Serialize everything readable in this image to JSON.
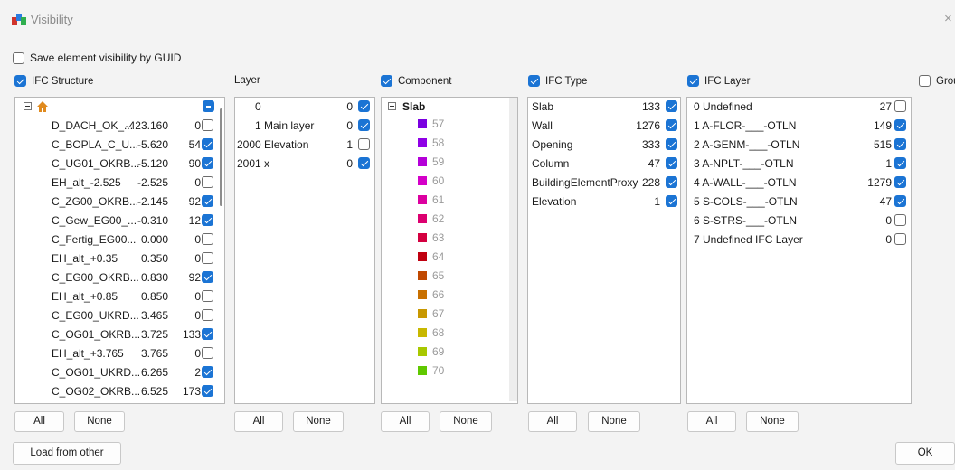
{
  "window": {
    "title": "Visibility",
    "close": "×"
  },
  "save_by_guid": {
    "label": "Save element visibility by GUID",
    "checked": false
  },
  "headers": {
    "ifc_structure": {
      "label": "IFC Structure",
      "checked": true
    },
    "layer": {
      "label": "Layer"
    },
    "component": {
      "label": "Component",
      "checked": true
    },
    "ifc_type": {
      "label": "IFC Type",
      "checked": true
    },
    "ifc_layer": {
      "label": "IFC Layer",
      "checked": true
    },
    "group": {
      "label": "Group",
      "checked": false
    }
  },
  "structure": {
    "rows": [
      {
        "name": "D_DACH_OK_...",
        "elev": "-423.160",
        "count": "0",
        "checked": false
      },
      {
        "name": "C_BOPLA_C_U...",
        "elev": "-5.620",
        "count": "54",
        "checked": true
      },
      {
        "name": "C_UG01_OKRB...",
        "elev": "-5.120",
        "count": "90",
        "checked": true
      },
      {
        "name": "EH_alt_-2.525",
        "elev": "-2.525",
        "count": "0",
        "checked": false
      },
      {
        "name": "C_ZG00_OKRB...",
        "elev": "-2.145",
        "count": "92",
        "checked": true
      },
      {
        "name": "C_Gew_EG00_...",
        "elev": "-0.310",
        "count": "12",
        "checked": true
      },
      {
        "name": "C_Fertig_EG00...",
        "elev": "0.000",
        "count": "0",
        "checked": false
      },
      {
        "name": "EH_alt_+0.35",
        "elev": "0.350",
        "count": "0",
        "checked": false
      },
      {
        "name": "C_EG00_OKRB...",
        "elev": "0.830",
        "count": "92",
        "checked": true
      },
      {
        "name": "EH_alt_+0.85",
        "elev": "0.850",
        "count": "0",
        "checked": false
      },
      {
        "name": "C_EG00_UKRD...",
        "elev": "3.465",
        "count": "0",
        "checked": false
      },
      {
        "name": "C_OG01_OKRB...",
        "elev": "3.725",
        "count": "133",
        "checked": true
      },
      {
        "name": "EH_alt_+3.765",
        "elev": "3.765",
        "count": "0",
        "checked": false
      },
      {
        "name": "C_OG01_UKRD...",
        "elev": "6.265",
        "count": "2",
        "checked": true
      },
      {
        "name": "C_OG02_OKRB...",
        "elev": "6.525",
        "count": "173",
        "checked": true
      }
    ]
  },
  "layers": [
    {
      "name": "0",
      "count": "0",
      "checked": true
    },
    {
      "name": "1 Main layer",
      "count": "0",
      "checked": true
    },
    {
      "name": "2000 Elevation",
      "count": "1",
      "checked": false
    },
    {
      "name": "2001 x",
      "count": "0",
      "checked": true
    }
  ],
  "components": {
    "group": "Slab",
    "items": [
      {
        "num": "57",
        "color": "#7a00e0"
      },
      {
        "num": "58",
        "color": "#8f00e6"
      },
      {
        "num": "59",
        "color": "#b400d8"
      },
      {
        "num": "60",
        "color": "#d400c8"
      },
      {
        "num": "61",
        "color": "#dc00a0"
      },
      {
        "num": "62",
        "color": "#dc0070"
      },
      {
        "num": "63",
        "color": "#d40040"
      },
      {
        "num": "64",
        "color": "#c00010"
      },
      {
        "num": "65",
        "color": "#c04800"
      },
      {
        "num": "66",
        "color": "#c87000"
      },
      {
        "num": "67",
        "color": "#c89800"
      },
      {
        "num": "68",
        "color": "#c8b800"
      },
      {
        "num": "69",
        "color": "#a8c800"
      },
      {
        "num": "70",
        "color": "#60c800"
      }
    ]
  },
  "ifc_types": [
    {
      "name": "Slab",
      "count": "133",
      "checked": true
    },
    {
      "name": "Wall",
      "count": "1276",
      "checked": true
    },
    {
      "name": "Opening",
      "count": "333",
      "checked": true
    },
    {
      "name": "Column",
      "count": "47",
      "checked": true
    },
    {
      "name": "BuildingElementProxy",
      "count": "228",
      "checked": true
    },
    {
      "name": "Elevation",
      "count": "1",
      "checked": true
    }
  ],
  "ifc_layers": [
    {
      "name": "0 Undefined",
      "count": "27",
      "checked": false
    },
    {
      "name": "1 A-FLOR-___-OTLN",
      "count": "149",
      "checked": true
    },
    {
      "name": "2 A-GENM-___-OTLN",
      "count": "515",
      "checked": true
    },
    {
      "name": "3 A-NPLT-___-OTLN",
      "count": "1",
      "checked": true
    },
    {
      "name": "4 A-WALL-___-OTLN",
      "count": "1279",
      "checked": true
    },
    {
      "name": "5 S-COLS-___-OTLN",
      "count": "47",
      "checked": true
    },
    {
      "name": "6 S-STRS-___-OTLN",
      "count": "0",
      "checked": false
    },
    {
      "name": "7 Undefined IFC Layer",
      "count": "0",
      "checked": false
    }
  ],
  "buttons": {
    "all": "All",
    "none": "None",
    "load": "Load from other scene...",
    "ok": "OK"
  },
  "colors": {
    "accent": "#1b74d4",
    "background": "#f3f3f3"
  }
}
